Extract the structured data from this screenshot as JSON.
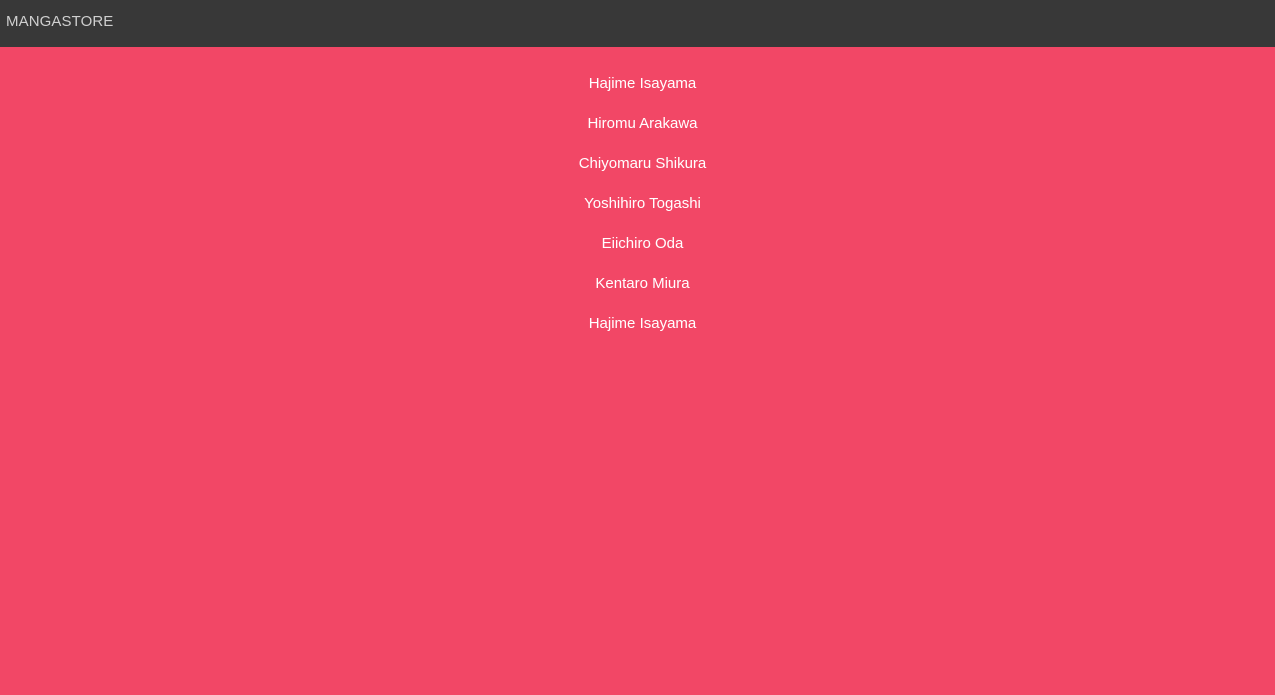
{
  "header": {
    "brand": "MANGASTORE"
  },
  "authors": [
    "Hajime Isayama",
    "Hiromu Arakawa",
    "Chiyomaru Shikura",
    "Yoshihiro Togashi",
    "Eiichiro Oda",
    "Kentaro Miura",
    "Hajime Isayama"
  ],
  "colors": {
    "topbar": "#383838",
    "background": "#f24766",
    "brand_text": "#cfcfcf",
    "list_text": "#ffffff"
  }
}
